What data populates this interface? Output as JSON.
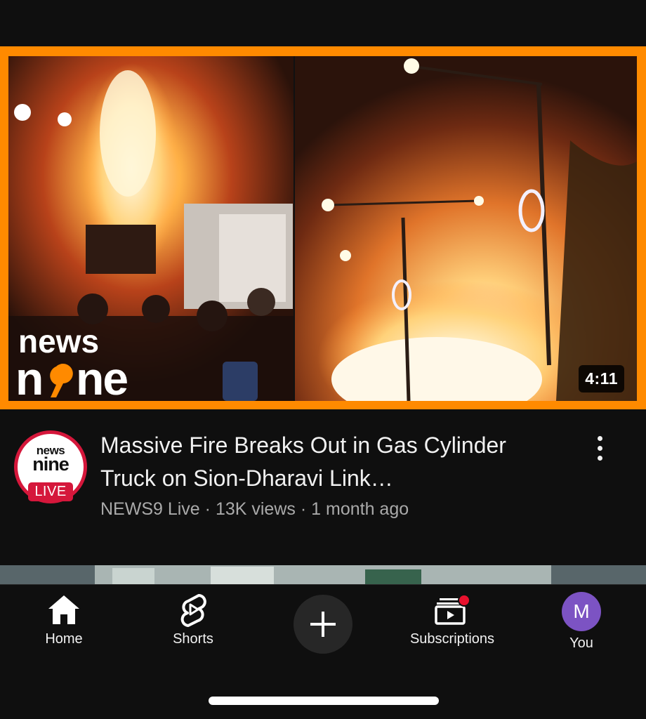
{
  "video": {
    "duration": "4:11",
    "watermark_top": "news",
    "watermark_bottom": "nine",
    "title": "Massive Fire Breaks Out in Gas Cylinder Truck on Sion-Dharavi Link…",
    "channel": "NEWS9 Live",
    "views": "13K views",
    "age": "1 month ago",
    "separator": "·"
  },
  "channel_avatar": {
    "top_text": "news",
    "nine_text": "nine",
    "live_badge": "LIVE"
  },
  "nav": {
    "items": [
      {
        "label": "Home",
        "icon": "home-icon"
      },
      {
        "label": "Shorts",
        "icon": "shorts-icon"
      },
      {
        "label": "",
        "icon": "plus-icon"
      },
      {
        "label": "Subscriptions",
        "icon": "subscriptions-icon"
      },
      {
        "label": "You",
        "icon": "avatar",
        "avatar_letter": "M"
      }
    ]
  },
  "colors": {
    "thumbnail_border": "#ff8a00",
    "background": "#0f0f0f",
    "live_red": "#d5173b",
    "notification_dot": "#e8112d",
    "user_avatar": "#7c53c3"
  }
}
